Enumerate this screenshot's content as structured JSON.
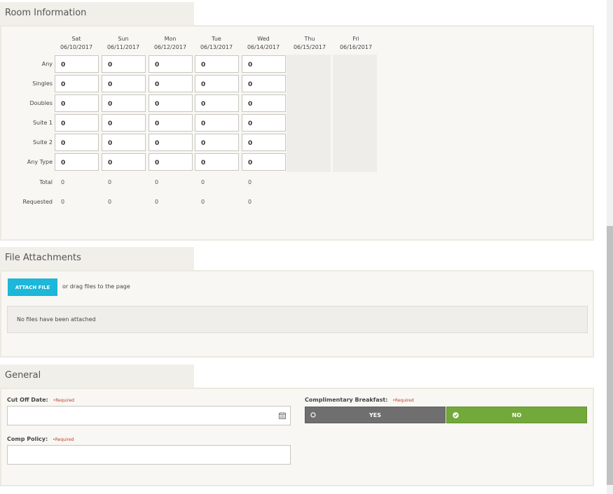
{
  "room": {
    "title": "Room Information",
    "days": [
      {
        "day": "Sat",
        "date": "06/10/2017"
      },
      {
        "day": "Sun",
        "date": "06/11/2017"
      },
      {
        "day": "Mon",
        "date": "06/12/2017"
      },
      {
        "day": "Tue",
        "date": "06/13/2017"
      },
      {
        "day": "Wed",
        "date": "06/14/2017"
      },
      {
        "day": "Thu",
        "date": "06/15/2017"
      },
      {
        "day": "Fri",
        "date": "06/16/2017"
      }
    ],
    "row_labels": [
      "Any",
      "Singles",
      "Doubles",
      "Suite 1",
      "Suite 2",
      "Any Type"
    ],
    "cell_values": [
      [
        "0",
        "0",
        "0",
        "0",
        "0"
      ],
      [
        "0",
        "0",
        "0",
        "0",
        "0"
      ],
      [
        "0",
        "0",
        "0",
        "0",
        "0"
      ],
      [
        "0",
        "0",
        "0",
        "0",
        "0"
      ],
      [
        "0",
        "0",
        "0",
        "0",
        "0"
      ],
      [
        "0",
        "0",
        "0",
        "0",
        "0"
      ]
    ],
    "total_label": "Total",
    "totals": [
      "0",
      "0",
      "0",
      "0",
      "0"
    ],
    "requested_label": "Requested",
    "requested": [
      "0",
      "0",
      "0",
      "0",
      "0"
    ]
  },
  "files": {
    "title": "File Attachments",
    "attach_label": "ATTACH FILE",
    "drag_text": "or drag files to the page",
    "empty_text": "No files have been attached"
  },
  "general": {
    "title": "General",
    "cutoff_label": "Cut Off Date:",
    "cutoff_value": "",
    "comp_policy_label": "Comp Policy:",
    "comp_policy_value": "",
    "breakfast_label": "Complimentary Breakfast:",
    "required_text": "•Required",
    "yes_label": "YES",
    "no_label": "NO",
    "yes_color": "#6f6f6f",
    "no_color": "#73a93a",
    "selected": "NO"
  }
}
